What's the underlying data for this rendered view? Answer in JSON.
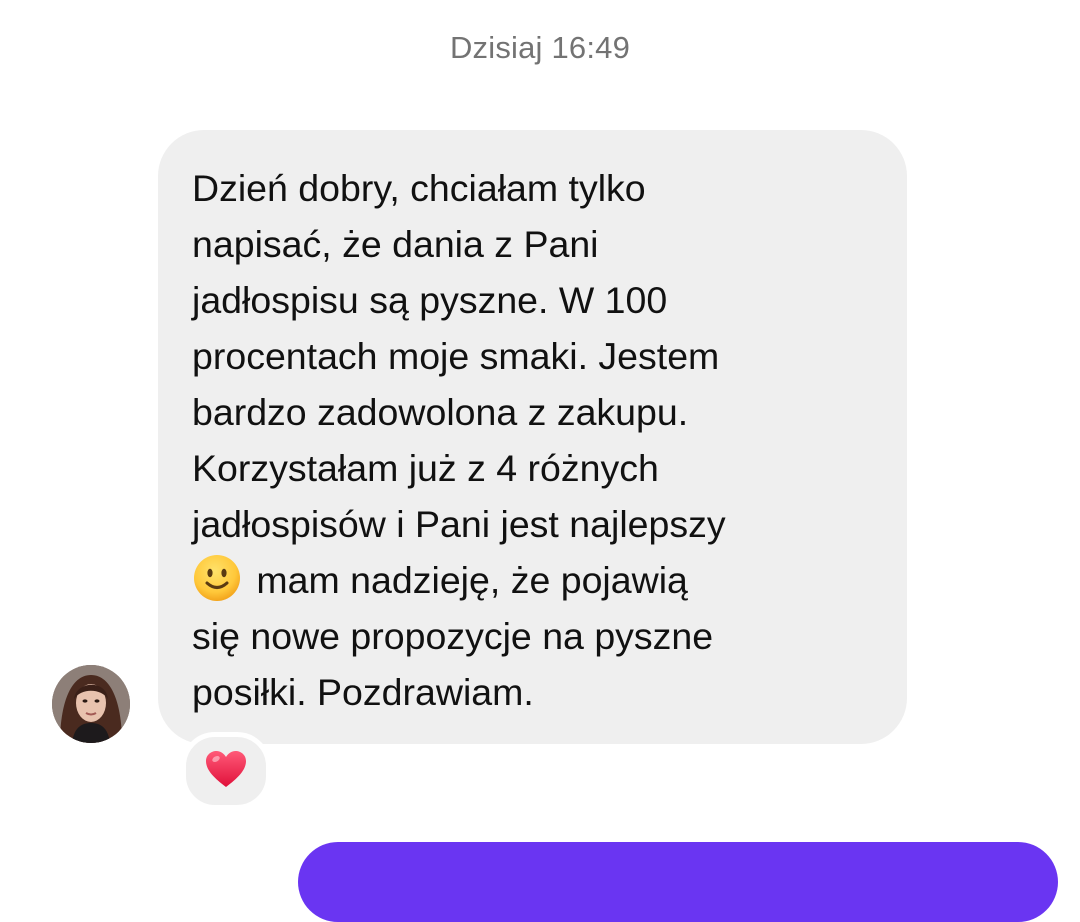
{
  "timestamp": "Dzisiaj 16:49",
  "message": {
    "sender": "incoming",
    "text_before_emoji": "Dzień dobry, chciałam tylko\nnapisać, że dania z Pani\njadłospisu są pyszne. W 100\nprocentach moje smaki. Jestem\nbardzo zadowolona z zakupu.\nKorzystałam już z 4 różnych\njadłospisów i Pani jest najlepszy\n",
    "emoji": "slightly-smiling-face",
    "text_after_emoji": " mam nadzieję, że pojawią\nsię nowe propozycje na pyszne\nposiłki. Pozdrawiam.",
    "reaction": "red-heart",
    "bubble_color": "#efefef"
  },
  "outgoing_bubble_color": "#6a35f2"
}
